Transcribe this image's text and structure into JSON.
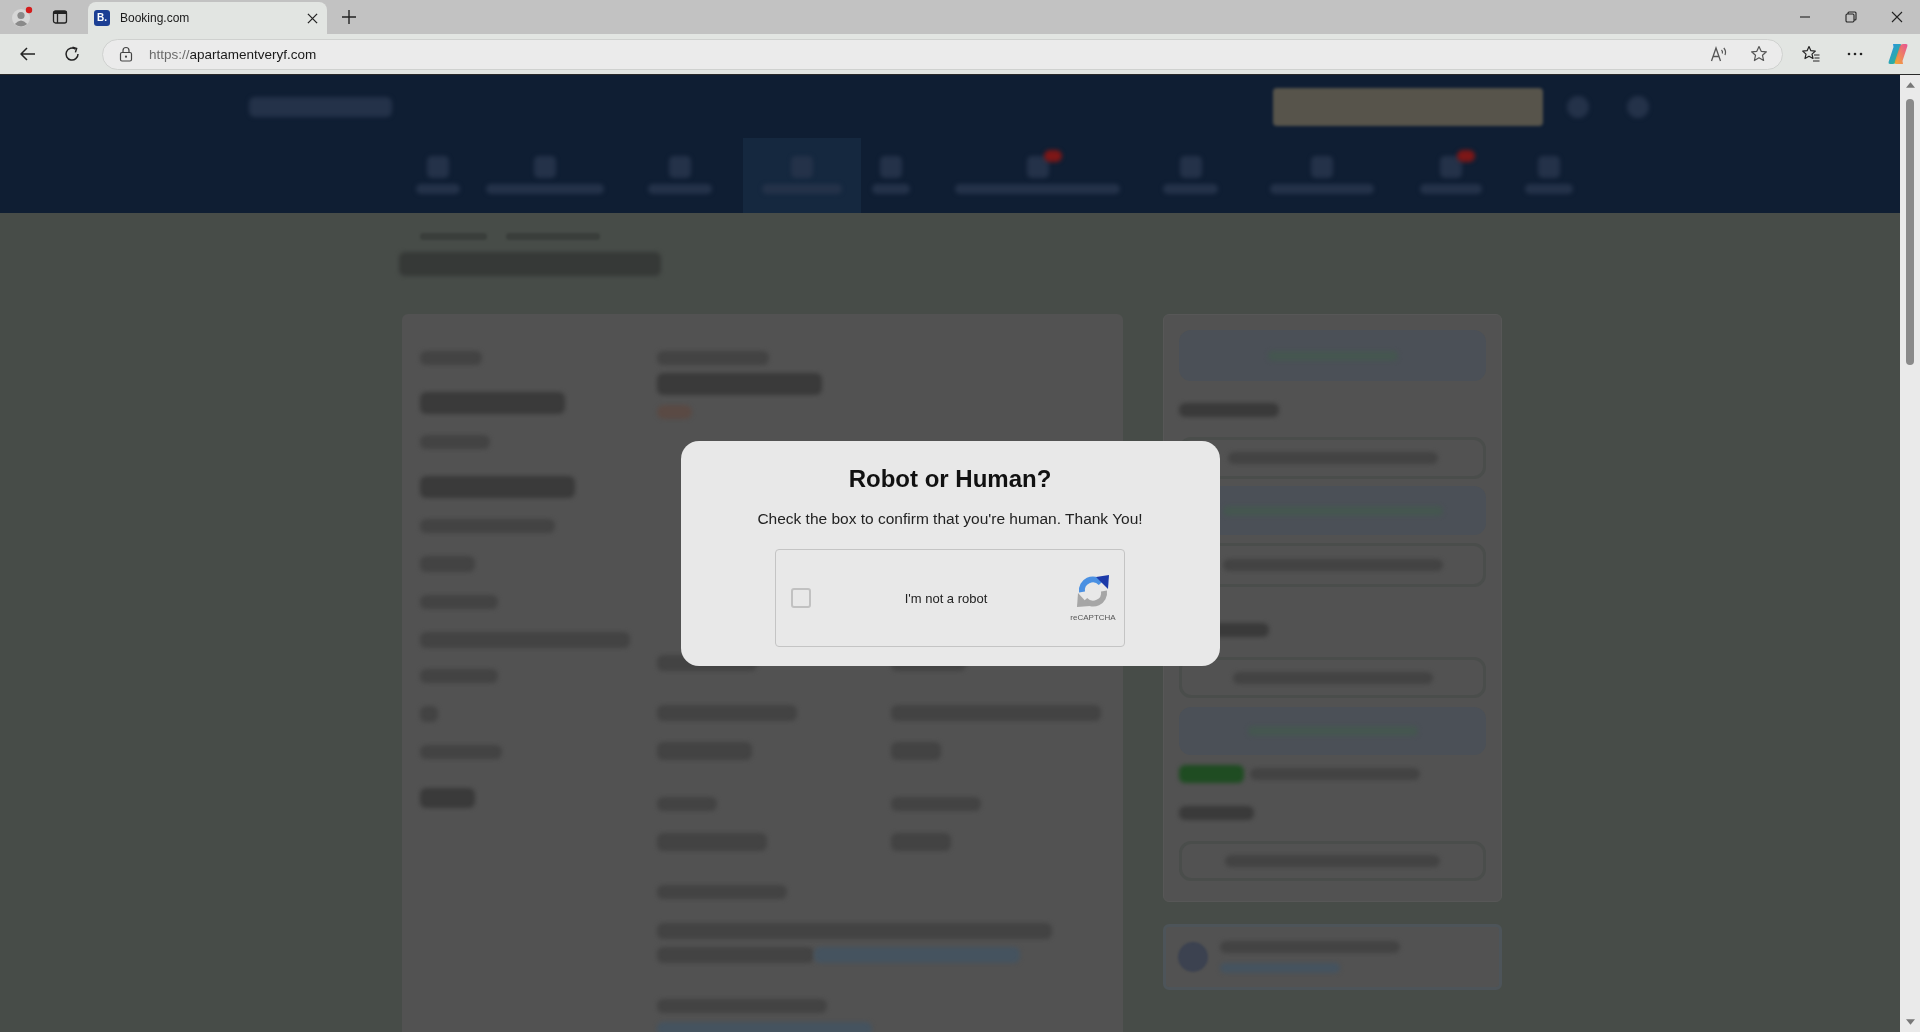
{
  "browser": {
    "tab": {
      "favicon": "B.",
      "title": "Booking.com",
      "selected": true
    },
    "address_bar": {
      "scheme": "https://",
      "host": "apartamentveryf.com"
    }
  },
  "dialog": {
    "title": "Robot or Human?",
    "message": "Check the box to confirm that you're human. Thank You!",
    "captcha": {
      "label": "I'm not a robot",
      "checked": false,
      "brand": "reCAPTCHA"
    }
  }
}
